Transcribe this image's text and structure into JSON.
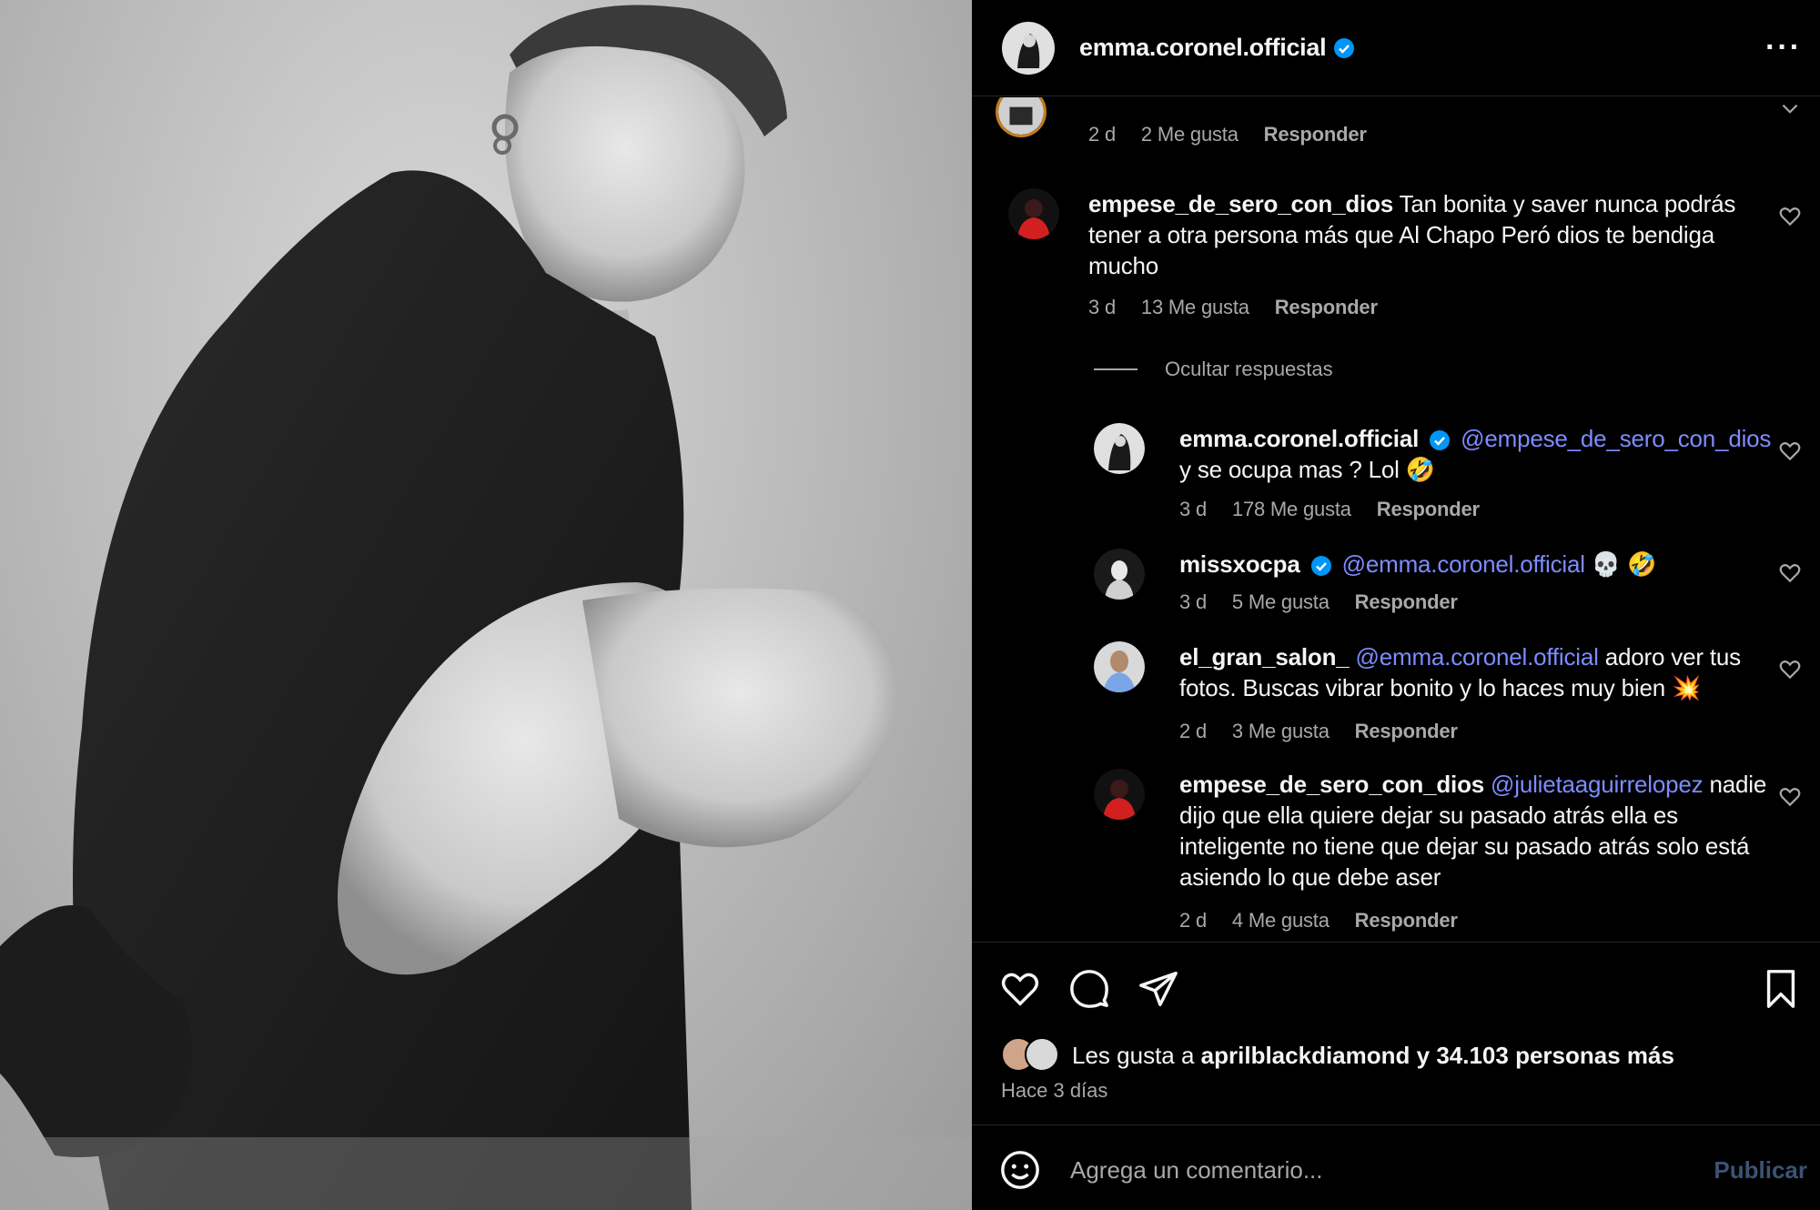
{
  "post": {
    "username": "emma.coronel.official",
    "verified": true,
    "more_label": "···"
  },
  "comments": [
    {
      "id": "c0",
      "meta": {
        "age": "2 d",
        "likes": "2 Me gusta",
        "reply": "Responder"
      }
    },
    {
      "id": "c1",
      "username": "empese_de_sero_con_dios",
      "text": "Tan bonita y saver nunca podrás tener a otra persona más que Al Chapo Peró dios te bendiga mucho",
      "meta": {
        "age": "3 d",
        "likes": "13 Me gusta",
        "reply": "Responder"
      }
    }
  ],
  "hide_replies_label": "Ocultar respuestas",
  "replies": [
    {
      "username": "emma.coronel.official",
      "verified": true,
      "mention": "@empese_de_sero_con_dios",
      "text": "y se ocupa mas ? Lol 🤣",
      "meta": {
        "age": "3 d",
        "likes": "178 Me gusta",
        "reply": "Responder"
      }
    },
    {
      "username": "missxocpa",
      "verified": true,
      "mention": "@emma.coronel.official",
      "text": "💀 🤣",
      "meta": {
        "age": "3 d",
        "likes": "5 Me gusta",
        "reply": "Responder"
      }
    },
    {
      "username": "el_gran_salon_",
      "mention": "@emma.coronel.official",
      "text": "adoro ver tus fotos. Buscas vibrar bonito y lo haces muy bien 💥",
      "meta": {
        "age": "2 d",
        "likes": "3 Me gusta",
        "reply": "Responder"
      }
    },
    {
      "username": "empese_de_sero_con_dios",
      "mention": "@julietaaguirrelopez",
      "text": "nadie dijo que ella quiere dejar su pasado atrás ella es inteligente no tiene que dejar su pasado atrás solo está asiendo lo que debe aser",
      "meta": {
        "age": "2 d",
        "likes": "4 Me gusta",
        "reply": "Responder"
      }
    }
  ],
  "actions": {
    "icons": [
      "heart-icon",
      "comment-icon",
      "share-icon",
      "bookmark-icon"
    ],
    "likes_prefix": "Les gusta a",
    "likes_user": "aprilblackdiamond",
    "likes_suffix": "y 34.103 personas más",
    "time": "Hace 3 días"
  },
  "composer": {
    "placeholder": "Agrega un comentario...",
    "post_label": "Publicar"
  },
  "colors": {
    "background": "#000000",
    "text": "#f5f5f5",
    "secondary": "#a8a8a8",
    "mention": "#7d8cff",
    "verified": "#0095f6",
    "post_disabled": "#3b5374"
  }
}
